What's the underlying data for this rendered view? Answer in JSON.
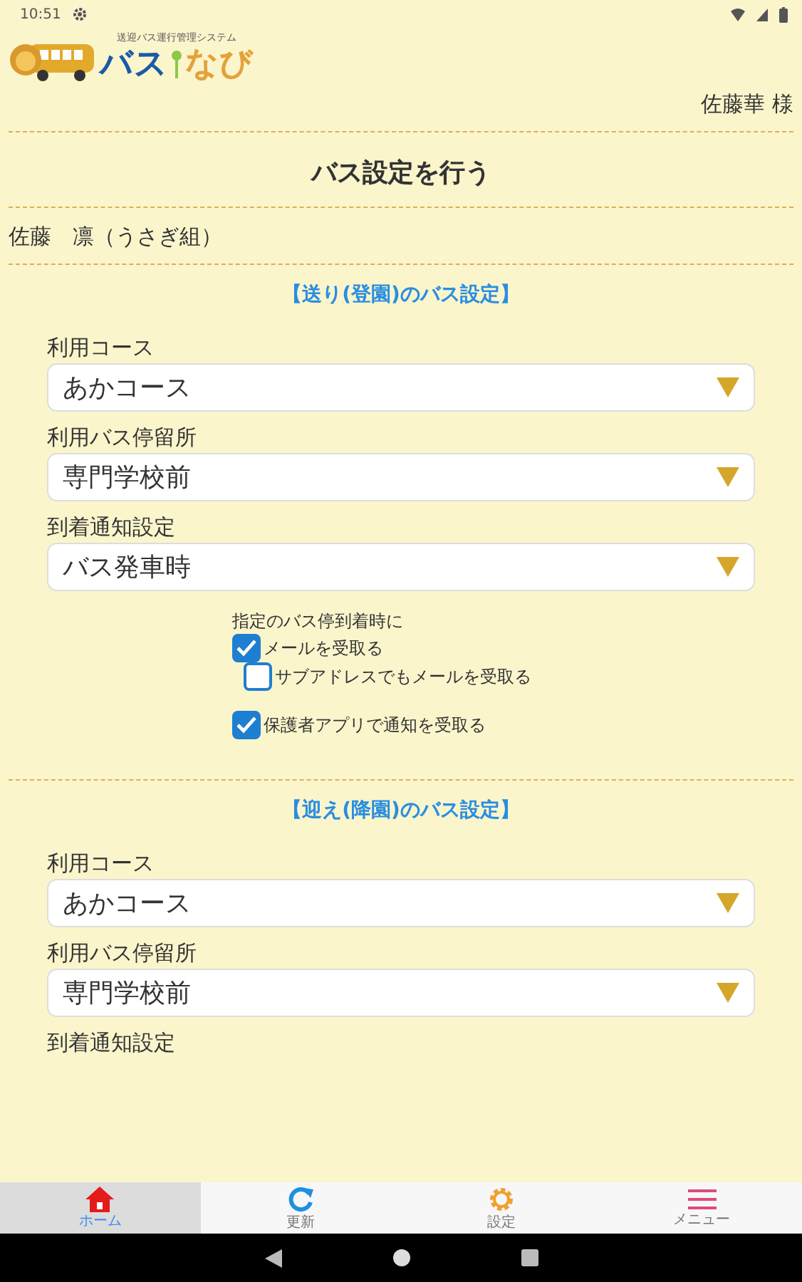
{
  "status_bar": {
    "time": "10:51"
  },
  "header": {
    "logo_tagline": "送迎バス運行管理システム",
    "logo_word_1": "バス",
    "logo_word_2": "なび",
    "user": "佐藤華 様"
  },
  "title": "バス設定を行う",
  "child": "佐藤　凛（うさぎ組）",
  "sections": [
    {
      "title": "【送り(登園)のバス設定】",
      "fields": [
        {
          "label": "利用コース",
          "value": "あかコース"
        },
        {
          "label": "利用バス停留所",
          "value": "専門学校前"
        },
        {
          "label": "到着通知設定",
          "value": "バス発車時"
        }
      ],
      "notify": {
        "caption": "指定のバス停到着時に",
        "options": [
          {
            "label": "メールを受取る",
            "checked": true,
            "kind": "main"
          },
          {
            "label": "サブアドレスでもメールを受取る",
            "checked": false,
            "kind": "sub"
          },
          {
            "label": "保護者アプリで通知を受取る",
            "checked": true,
            "kind": "app"
          }
        ]
      }
    },
    {
      "title": "【迎え(降園)のバス設定】",
      "fields": [
        {
          "label": "利用コース",
          "value": "あかコース"
        },
        {
          "label": "利用バス停留所",
          "value": "専門学校前"
        },
        {
          "label": "到着通知設定"
        }
      ]
    }
  ],
  "tabs": [
    {
      "label": "ホーム",
      "selected": true,
      "kind": "home"
    },
    {
      "label": "更新",
      "selected": false,
      "kind": "refresh"
    },
    {
      "label": "設定",
      "selected": false,
      "kind": "settings"
    },
    {
      "label": "メニュー",
      "selected": false,
      "kind": "menu"
    }
  ]
}
